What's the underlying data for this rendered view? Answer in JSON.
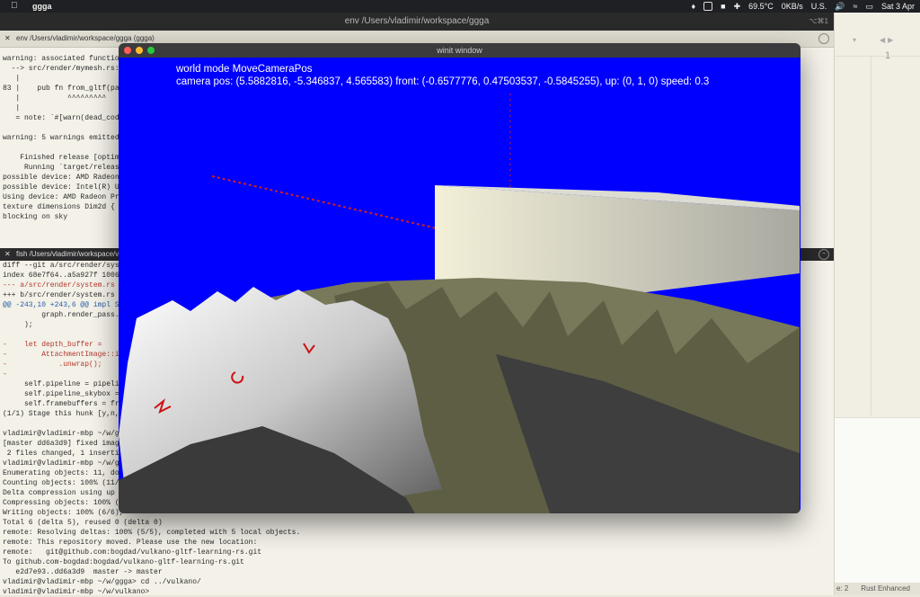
{
  "menubar": {
    "app_name": "ggga",
    "items": [
      "69.5°C",
      "0KB/s",
      "U.S.",
      "Sat 3 Apr"
    ]
  },
  "terminal": {
    "window_title": "env /Users/vladimir/workspace/ggga",
    "shortcut": "⌥⌘1",
    "tab1_label": "env /Users/vladimir/workspace/ggga (ggga)",
    "tab2_label": "fish /Users/vladimir/workspace/vu",
    "pane1_lines": [
      "warning: associated function",
      "  --> src/render/mymesh.rs:83",
      "   |",
      "83 |    pub fn from_gltf(path:",
      "   |           ^^^^^^^^^",
      "   |",
      "   = note: `#[warn(dead_code)",
      "",
      "warning: 5 warnings emitted",
      "",
      "    Finished release [optimiz",
      "     Running `target/release/",
      "possible device: AMD Radeon P",
      "possible device: Intel(R) UHD",
      "Using device: AMD Radeon Pro",
      "texture dimensions Dim2d { wi",
      "blocking on sky"
    ],
    "pane2_lines": [
      "diff --git a/src/render/syste",
      "index 68e7f64..a5a927f 10064",
      "--- a/src/render/system.rs",
      "+++ b/src/render/system.rs",
      "@@ -243,10 +243,6 @@ impl Sys",
      "         graph.render_pass.cl",
      "     );",
      "",
      "-    let depth_buffer =",
      "-        AttachmentImage::input",
      "-            .unwrap();",
      "-",
      "     self.pipeline = pipeline",
      "     self.pipeline_skybox = p",
      "     self.framebuffers = fram",
      "(1/1) Stage this hunk [y,n,q,",
      "",
      "vladimir@vladimir-mbp ~/w/ggg",
      "[master dd6a3d9] fixed image",
      " 2 files changed, 1 insertion",
      "vladimir@vladimir-mbp ~/w/ggg",
      "Enumerating objects: 11, done",
      "Counting objects: 100% (11/11",
      "Delta compression using up to",
      "Compressing objects: 100% (6/",
      "Writing objects: 100% (6/6),",
      "Total 6 (delta 5), reused 0 (delta 0)",
      "remote: Resolving deltas: 100% (5/5), completed with 5 local objects.",
      "remote: This repository moved. Please use the new location:",
      "remote:   git@github.com:bogdad/vulkano-gltf-learning-rs.git",
      "To github.com-bogdad:bogdad/vulkano-gltf-learning-rs.git",
      "   e2d7e93..dd6a3d9  master -> master",
      "vladimir@vladimir-mbp ~/w/ggga> cd ../vulkano/",
      "vladimir@vladimir-mbp ~/w/vulkano> "
    ]
  },
  "editor": {
    "line_number": "1",
    "status_left": "e: 2",
    "status_right": "Rust Enhanced"
  },
  "winit": {
    "title": "winit window",
    "line1": "world mode MoveCameraPos",
    "line2": "camera pos: (5.5882816, -5.346837, 4.565583) front: (-0.6577776, 0.47503537, -0.5845255), up: (0, 1, 0) speed: 0.3"
  }
}
